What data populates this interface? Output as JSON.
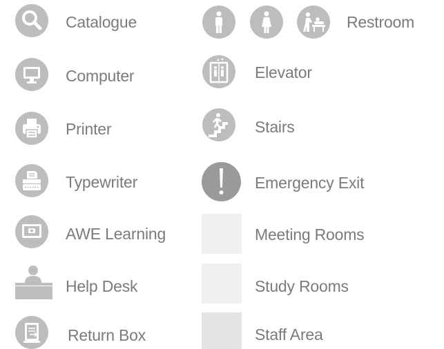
{
  "legend": {
    "left_column": [
      {
        "id": "catalogue",
        "label": "Catalogue",
        "icon": "magnifier-icon"
      },
      {
        "id": "computer",
        "label": "Computer",
        "icon": "monitor-icon"
      },
      {
        "id": "printer",
        "label": "Printer",
        "icon": "printer-icon"
      },
      {
        "id": "typewriter",
        "label": "Typewriter",
        "icon": "typewriter-icon"
      },
      {
        "id": "awe-learning",
        "label": "AWE Learning",
        "icon": "screen-icon"
      },
      {
        "id": "help-desk",
        "label": "Help Desk",
        "icon": "person-at-desk-icon"
      },
      {
        "id": "return-box",
        "label": "Return Box",
        "icon": "book-return-icon"
      }
    ],
    "right_column": [
      {
        "id": "restroom",
        "label": "Restroom",
        "icons": [
          "man-icon",
          "woman-icon",
          "baby-changing-icon"
        ]
      },
      {
        "id": "elevator",
        "label": "Elevator",
        "icon": "elevator-icon"
      },
      {
        "id": "stairs",
        "label": "Stairs",
        "icon": "stairs-icon"
      },
      {
        "id": "emergency-exit",
        "label": "Emergency Exit",
        "icon": "exclamation-icon"
      },
      {
        "id": "meeting-rooms",
        "label": "Meeting Rooms",
        "swatch": "#f0f0f0"
      },
      {
        "id": "study-rooms",
        "label": "Study Rooms",
        "swatch": "#f0f0f0"
      },
      {
        "id": "staff-area",
        "label": "Staff Area",
        "swatch": "#e4e4e4"
      }
    ],
    "colors": {
      "icon_bg": "#bdbdbd",
      "icon_fg": "#ffffff",
      "exit_bg": "#9a9a9a",
      "text": "#7b7b7b"
    }
  }
}
